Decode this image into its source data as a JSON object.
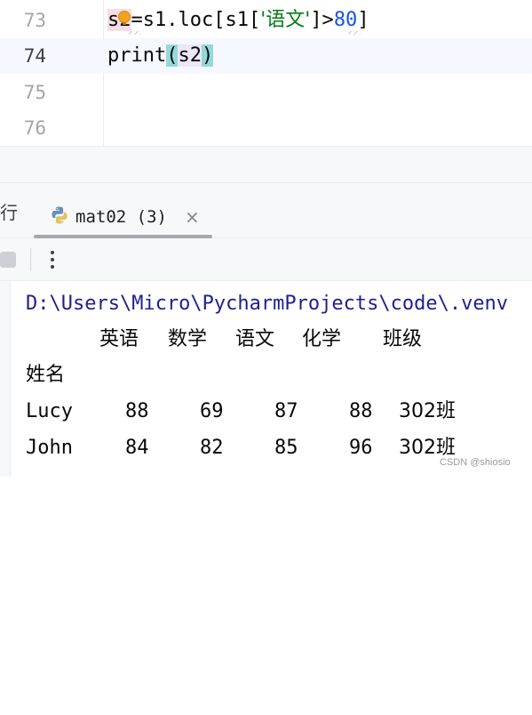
{
  "editor": {
    "lines": [
      {
        "number": "73",
        "tokens": {
          "var": "s2",
          "assign": "=s1.loc[s1[",
          "str": "'语文'",
          "close": "]>",
          "num": "80",
          "end": "]"
        }
      },
      {
        "number": "74",
        "tokens": {
          "fn": "print",
          "open": "(",
          "arg": "s2",
          "close": ")"
        }
      },
      {
        "number": "75"
      },
      {
        "number": "76"
      }
    ]
  },
  "run_window": {
    "prev_tab_label": "行",
    "tab": {
      "label": "mat02 (3)",
      "close": "×",
      "icon": "python-icon"
    },
    "toolbar": {
      "more": "⋮"
    }
  },
  "console": {
    "path": "D:\\Users\\Micro\\PycharmProjects\\code\\.venv",
    "header": [
      "英语",
      "数学",
      "语文",
      "化学",
      "班级"
    ],
    "index_name": "姓名",
    "rows": [
      {
        "name": "Lucy",
        "values": [
          "88",
          "69",
          "87",
          "88",
          "302班"
        ]
      },
      {
        "name": "John",
        "values": [
          "84",
          "82",
          "85",
          "96",
          "302班"
        ]
      }
    ]
  },
  "watermark": "CSDN @shiosio"
}
